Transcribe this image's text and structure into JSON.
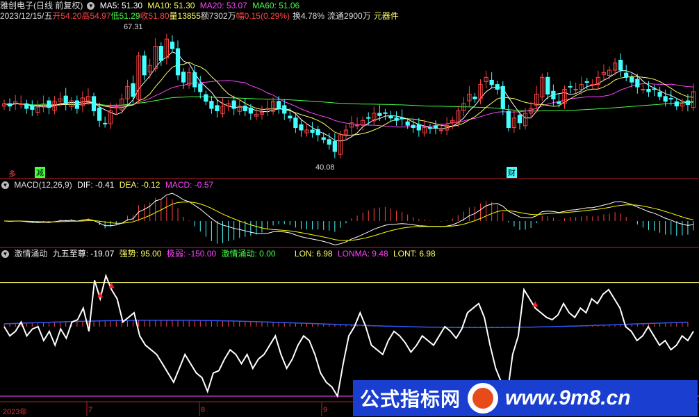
{
  "header1": {
    "name": "雅创电子",
    "period": "(日线 前复权)",
    "ma5": "MA5: 51.30",
    "ma10": "MA10: 51.30",
    "ma20": "MA20: 53.07",
    "ma60": "MA60: 51.06"
  },
  "header2": {
    "date": "2023/12/15/五",
    "open": "开54.20",
    "high": "高54.97",
    "low": "低51.29",
    "close": "收51.80",
    "volume": "量13855",
    "amount": "额7302万",
    "change": "幅0.15(0.29%)",
    "turnover": "换4.78%",
    "float": "流通2900万",
    "sector": "元器件"
  },
  "price_labels": {
    "high": "67.31",
    "low": "40.08"
  },
  "signals": {
    "s1": "多",
    "s2": "减",
    "s3": "财"
  },
  "macd_header": {
    "name": "MACD(12,26,9)",
    "dif": "DIF: -0.41",
    "dea": "DEA: -0.12",
    "macd": "MACD: -0.57"
  },
  "ind_header": {
    "name": "激情涌动",
    "v1": "九五至尊: -19.07",
    "v2": "强势: 95.00",
    "v3": "极弱: -150.00",
    "v4": "激情涌动: 0.00",
    "v5": "LON: 6.98",
    "v6": "LONMA: 9.48",
    "v7": "LONT: 6.98"
  },
  "x_labels": [
    "2023年",
    "7",
    "8",
    "9"
  ],
  "watermark": {
    "text1": "公式指标网",
    "text2": "www.9m8.cn"
  },
  "colors": {
    "up": "#ff4444",
    "down": "#44ffff",
    "ma5": "#ffffff",
    "ma10": "#ffff66",
    "ma20": "#ff44ff",
    "ma60": "#44ff44",
    "dif": "#ffffff",
    "dea": "#ffff00",
    "line": "#ffffff",
    "lonma": "#3355ff"
  },
  "chart_data": {
    "type": "candlestick",
    "close": [
      52.0,
      51.5,
      52.4,
      52.0,
      51.0,
      50.8,
      51.3,
      52.0,
      51.2,
      52.5,
      53.0,
      52.0,
      52.6,
      51.0,
      53.2,
      53.5,
      50.5,
      48.5,
      47.8,
      50.5,
      51.3,
      53.0,
      55.6,
      53.5,
      62.0,
      58.0,
      60.0,
      64.0,
      61.0,
      65.5,
      63.5,
      58.0,
      56.5,
      58.5,
      55.5,
      54.5,
      52.5,
      51.0,
      50.5,
      51.5,
      52.0,
      51.0,
      51.5,
      50.5,
      50.0,
      49.8,
      50.2,
      51.0,
      52.5,
      51.0,
      50.0,
      49.0,
      47.0,
      46.5,
      46.5,
      46.0,
      45.5,
      44.5,
      43.5,
      42.0,
      45.5,
      46.5,
      48.0,
      47.5,
      48.5,
      49.0,
      50.0,
      49.5,
      50.0,
      49.0,
      48.5,
      48.8,
      47.5,
      47.0,
      46.5,
      47.0,
      46.8,
      47.0,
      46.5,
      47.5,
      48.5,
      50.5,
      52.0,
      54.0,
      53.0,
      56.0,
      57.5,
      56.0,
      55.0,
      51.0,
      47.0,
      49.0,
      48.0,
      50.0,
      51.0,
      54.0,
      57.5,
      54.0,
      53.0,
      52.0,
      55.0,
      55.5,
      55.0,
      56.0,
      56.5,
      56.0,
      57.5,
      58.5,
      59.0,
      60.5,
      59.0,
      57.5,
      56.5,
      55.5,
      55.0,
      54.5,
      55.0,
      53.5,
      52.5,
      53.0,
      51.5,
      52.0,
      51.8,
      54.5
    ],
    "ma5_last": 51.3,
    "ma10_last": 51.3,
    "ma20_last": 53.07,
    "ma60_last": 51.06,
    "price_high": 67.31,
    "price_low": 40.08,
    "macd": {
      "dif": -0.41,
      "dea": -0.12,
      "macd": -0.57
    },
    "indicator": {
      "九五至尊": -19.07,
      "强势": 95.0,
      "极弱": -150.0,
      "激情涌动": 0.0,
      "LON": 6.98,
      "LONMA": 9.48,
      "LONT": 6.98,
      "line": [
        0,
        -20,
        -10,
        10,
        -20,
        -5,
        0,
        -30,
        -10,
        -40,
        -5,
        -25,
        10,
        15,
        40,
        -10,
        100,
        60,
        110,
        80,
        60,
        10,
        20,
        30,
        -20,
        -40,
        -50,
        -60,
        -80,
        -100,
        -120,
        -90,
        -60,
        -80,
        -100,
        -110,
        -140,
        -100,
        -95,
        -70,
        -50,
        -60,
        -80,
        -60,
        -90,
        -70,
        -60,
        -40,
        -20,
        -60,
        -90,
        -70,
        -40,
        -20,
        -30,
        -60,
        -100,
        -120,
        -130,
        -150,
        -80,
        -20,
        0,
        30,
        0,
        -40,
        -50,
        -60,
        -30,
        -10,
        -20,
        -35,
        -55,
        -40,
        -20,
        -30,
        -40,
        -20,
        0,
        -10,
        -25,
        -5,
        30,
        40,
        50,
        20,
        -40,
        -90,
        -120,
        -150,
        -60,
        -20,
        80,
        60,
        40,
        30,
        20,
        15,
        25,
        50,
        30,
        20,
        40,
        30,
        60,
        50,
        70,
        80,
        60,
        40,
        0,
        -10,
        -30,
        -20,
        0,
        -20,
        -40,
        -30,
        -50,
        -40,
        -20,
        -30,
        -10
      ]
    }
  }
}
